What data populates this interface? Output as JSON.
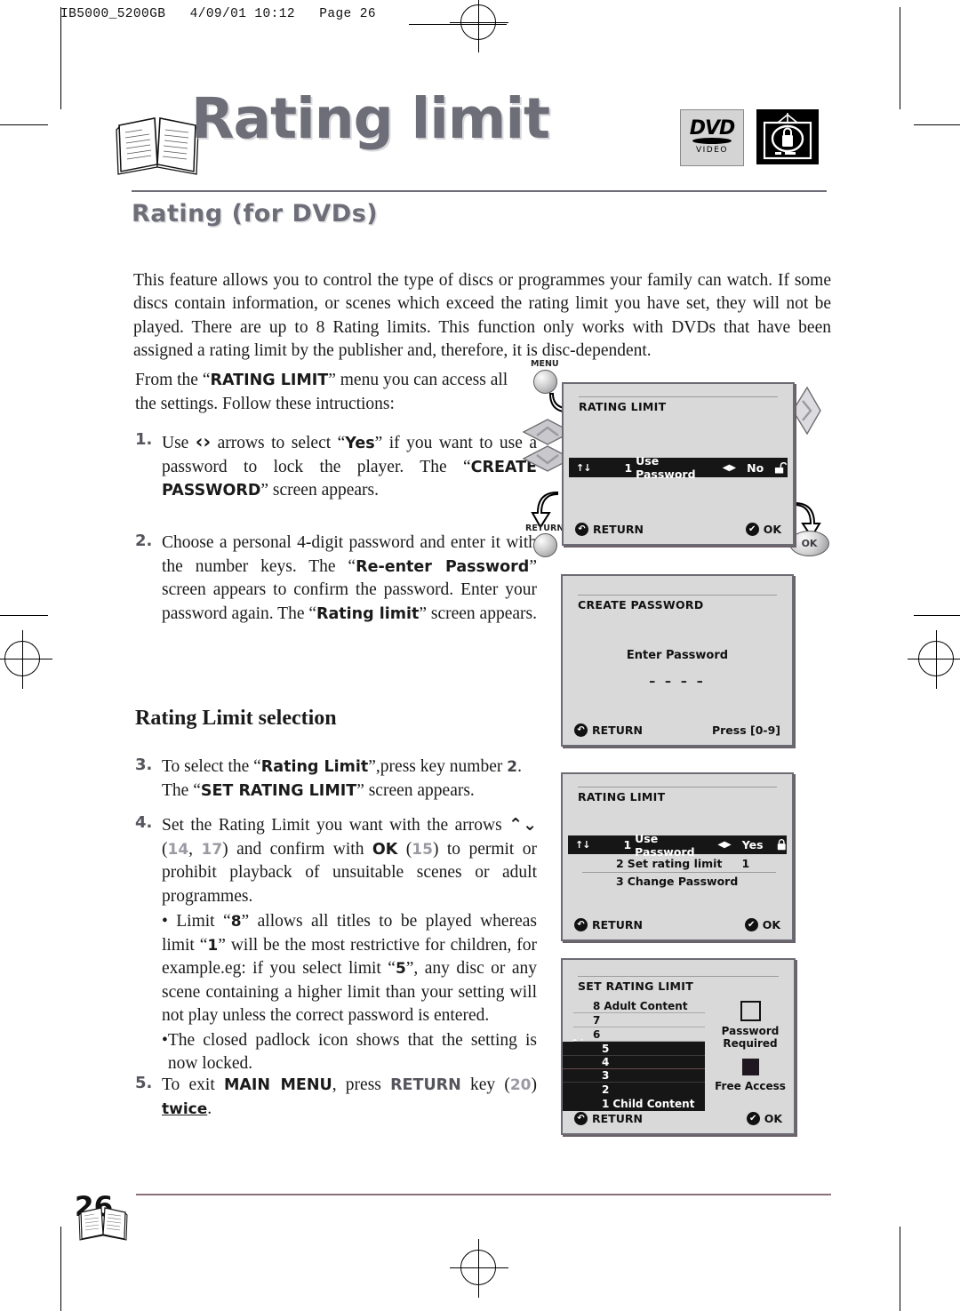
{
  "print_slug": "IB5000_5200GB   4/09/01 10:12   Page 26",
  "masthead": {
    "title": "Rating limit",
    "logo_dvd_top": "DVD",
    "logo_dvd_bottom": "VIDEO",
    "logo_tv_name": "tv-padlock-icon"
  },
  "section_heading": "Rating (for DVDs)",
  "intro": "This feature allows you to control the type of discs or programmes your family can watch. If some discs contain information, or scenes which exceed the rating limit you have set, they will not be played. There are up to 8 Rating limits. This function only works with DVDs that have been assigned a rating limit by the publisher and, therefore, it is disc-dependent.",
  "lead": {
    "part1": "From the “",
    "bold1": "RATING LIMIT",
    "part2": "” menu you can access all the settings. Follow these intructions:"
  },
  "steps": {
    "s1": {
      "num": "1.",
      "t1": "Use ",
      "arrows": "‹›",
      "t2": " arrows to select “",
      "b1": "Yes",
      "t3": "” if you want to use a password to lock the player. The “",
      "b2": "CREATE PASSWORD",
      "t4": "” screen appears."
    },
    "s2": {
      "num": "2.",
      "t1": "Choose a personal 4-digit password and enter it with the number keys. The “",
      "b1": "Re-enter Password",
      "t2": "” screen appears to confirm the password. Enter your password again. The “",
      "b2": "Rating limit",
      "t3": "” screen appears."
    },
    "s3": {
      "num": "3.",
      "t1": "To select the “",
      "b1": "Rating Limit",
      "t2": "”,press key number ",
      "g1": "2",
      "t3": ". The “",
      "b2": "SET RATING LIMIT",
      "t4": "” screen appears."
    },
    "s4": {
      "num": "4.",
      "t1": "Set the Rating Limit you want with the arrows ",
      "arrows": "⌃⌄",
      "t2": " (",
      "g1": "14",
      "t3": ", ",
      "g2": "17",
      "t4": ") and confirm with ",
      "b1": "OK",
      "t5": " (",
      "g3": "15",
      "t6": ") to permit or prohibit playback of unsuitable scenes or adult programmes.",
      "bullet1_a": "• Limit “",
      "bullet1_b1": "8",
      "bullet1_b": "” allows all titles to be played whereas limit “",
      "bullet1_b2": "1",
      "bullet1_c": "” will be the most restrictive for children, for example.eg: if you select limit “",
      "bullet1_b3": "5",
      "bullet1_d": "”, any disc or any scene containing a higher limit than your setting will not play unless the correct password is entered.",
      "bullet2": "The closed padlock icon shows that the setting is now locked."
    },
    "s5": {
      "num": "5.",
      "t1": "To exit ",
      "b1": "MAIN MENU",
      "t2": ", press ",
      "b2": "RETURN",
      "t3": " key (",
      "g1": "20",
      "t4": ") ",
      "u1": "twice",
      "t5": "."
    }
  },
  "subheading": "Rating Limit selection",
  "screens": {
    "screen1": {
      "title": "RATING LIMIT",
      "row": {
        "updown": "↑↓",
        "index": "1",
        "label": "Use Password",
        "lr": "◀▶",
        "value": "No",
        "lock": "padlock-open-icon"
      },
      "footer_left": "RETURN",
      "footer_left_badge": "↶",
      "footer_right": "OK",
      "footer_right_badge": "✔"
    },
    "screen2": {
      "title": "CREATE PASSWORD",
      "prompt": "Enter Password",
      "digits": "– – – –",
      "footer_left": "RETURN",
      "footer_left_badge": "↶",
      "footer_right": "Press [0-9]"
    },
    "screen3": {
      "title": "RATING LIMIT",
      "updown": "↑↓",
      "rows": [
        {
          "index": "1",
          "label": "Use Password",
          "lr": "◀▶",
          "value": "Yes",
          "lock": "padlock-closed-icon",
          "highlight": true
        },
        {
          "index": "2",
          "label": "Set rating limit",
          "lr": "",
          "value": "1",
          "lock": "",
          "highlight": false
        },
        {
          "index": "3",
          "label": "Change Password",
          "lr": "",
          "value": "",
          "lock": "",
          "highlight": false
        }
      ],
      "footer_left": "RETURN",
      "footer_left_badge": "↶",
      "footer_right": "OK",
      "footer_right_badge": "✔"
    },
    "screen4": {
      "title": "SET RATING LIMIT",
      "updown": "↑↓",
      "levels": [
        {
          "num": "8",
          "label": "Adult Content",
          "selected": false
        },
        {
          "num": "7",
          "label": "",
          "selected": false
        },
        {
          "num": "6",
          "label": "",
          "selected": false
        },
        {
          "num": "5",
          "label": "",
          "selected": true
        },
        {
          "num": "4",
          "label": "",
          "selected": true
        },
        {
          "num": "3",
          "label": "",
          "selected": true
        },
        {
          "num": "2",
          "label": "",
          "selected": true
        },
        {
          "num": "1",
          "label": "Child Content",
          "selected": true
        }
      ],
      "legend_password": "Password\nRequired",
      "legend_password_l1": "Password",
      "legend_password_l2": "Required",
      "legend_free": "Free Access",
      "footer_left": "RETURN",
      "footer_left_badge": "↶",
      "footer_right": "OK",
      "footer_right_badge": "✔"
    }
  },
  "remote": {
    "menu_label": "MENU",
    "return_label": "RETURN",
    "ok_label": "OK"
  },
  "page_number": "26",
  "colors": {
    "accent_gray": "#6e6e78",
    "osd_bg": "#d9d9d9",
    "osd_highlight": "#161616",
    "footer_rule": "#8a7078"
  }
}
